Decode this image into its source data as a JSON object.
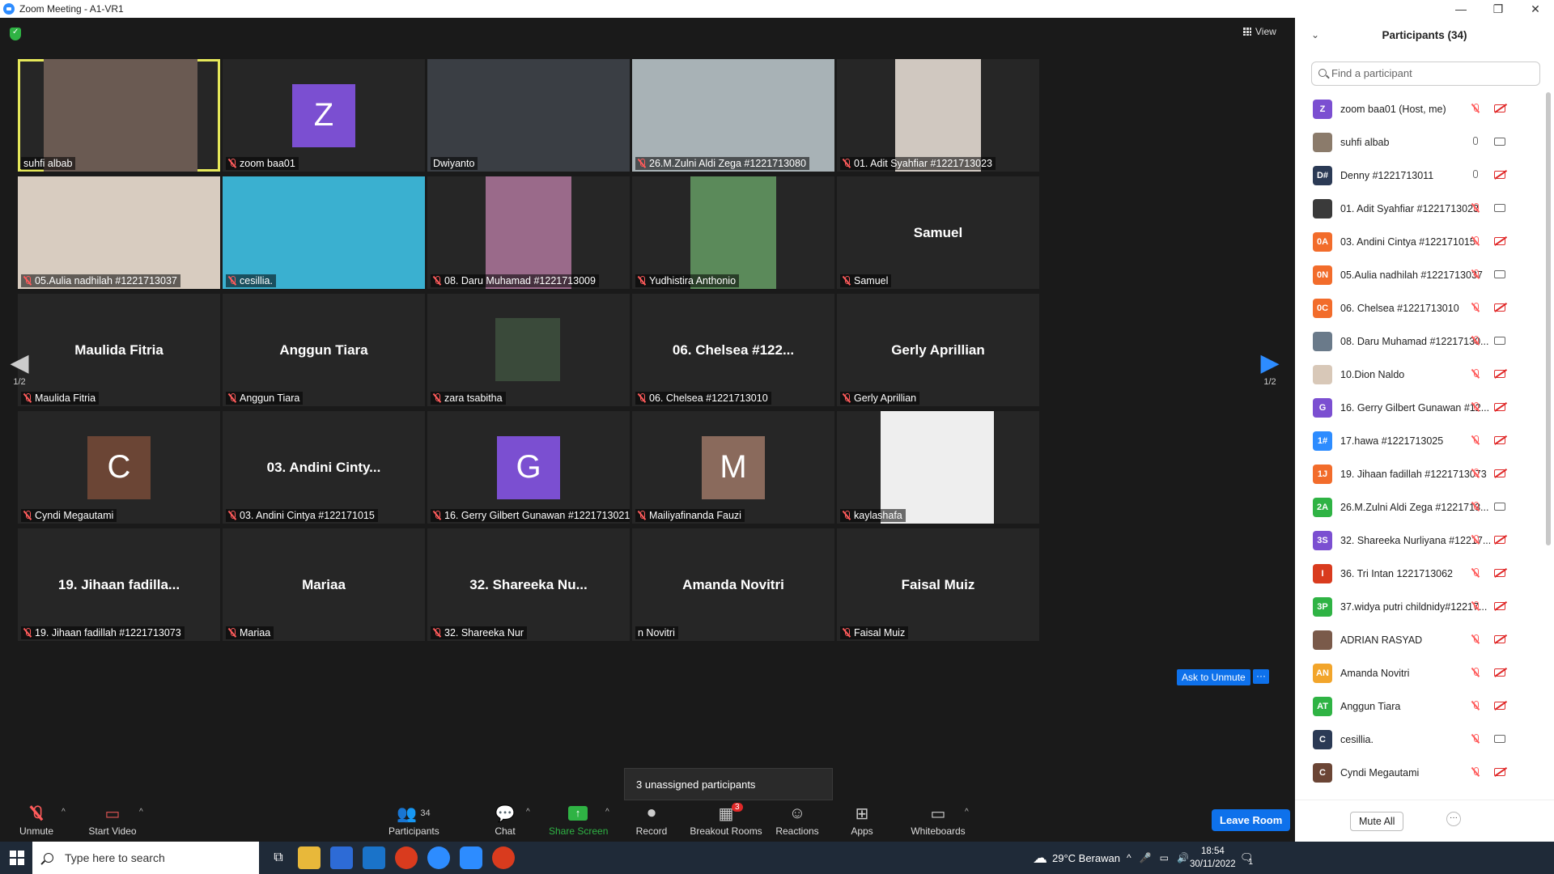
{
  "window": {
    "title": "Zoom Meeting - A1-VR1",
    "controls": [
      "—",
      "❐",
      "✕"
    ]
  },
  "meeting": {
    "view_label": "View",
    "page_indicator_left": "1/2",
    "page_indicator_right": "1/2",
    "ask_to_unmute": "Ask to Unmute",
    "more": "···",
    "unassigned_tooltip": "3 unassigned participants",
    "tiles": [
      {
        "label": "suhfi albab",
        "big": "",
        "avatar": "",
        "muted": false
      },
      {
        "label": "zoom baa01",
        "big": "",
        "avatar": "Z",
        "muted": true
      },
      {
        "label": "Dwiyanto",
        "big": "",
        "avatar": "",
        "muted": false
      },
      {
        "label": "26.M.Zulni Aldi Zega #1221713080",
        "big": "",
        "avatar": "",
        "muted": true
      },
      {
        "label": "01. Adit Syahfiar #1221713023",
        "big": "",
        "avatar": "",
        "muted": true
      },
      {
        "label": "05.Aulia nadhilah #1221713037",
        "big": "",
        "avatar": "",
        "muted": true
      },
      {
        "label": "cesillia.",
        "big": "",
        "avatar": "",
        "muted": true
      },
      {
        "label": "08. Daru Muhamad #1221713009",
        "big": "",
        "avatar": "",
        "muted": true
      },
      {
        "label": "Yudhistira Anthonio",
        "big": "",
        "avatar": "",
        "muted": true
      },
      {
        "label": "Samuel",
        "big": "Samuel",
        "avatar": "",
        "muted": true
      },
      {
        "label": "Maulida Fitria",
        "big": "Maulida Fitria",
        "avatar": "",
        "muted": true
      },
      {
        "label": "Anggun Tiara",
        "big": "Anggun Tiara",
        "avatar": "",
        "muted": true
      },
      {
        "label": "zara tsabitha",
        "big": "",
        "avatar": "",
        "muted": true
      },
      {
        "label": "06. Chelsea #1221713010",
        "big": "06. Chelsea #122...",
        "avatar": "",
        "muted": true
      },
      {
        "label": "Gerly Aprillian",
        "big": "Gerly Aprillian",
        "avatar": "",
        "muted": true
      },
      {
        "label": "Cyndi Megautami",
        "big": "",
        "avatar": "C",
        "muted": true
      },
      {
        "label": "03. Andini Cintya #122171015",
        "big": "03. Andini Cinty...",
        "avatar": "",
        "muted": true
      },
      {
        "label": "16. Gerry Gilbert Gunawan #1221713021",
        "big": "",
        "avatar": "G",
        "muted": true
      },
      {
        "label": "Mailiyafinanda Fauzi",
        "big": "",
        "avatar": "M",
        "muted": true
      },
      {
        "label": "kaylashafa",
        "big": "",
        "avatar": "",
        "muted": true
      },
      {
        "label": "19. Jihaan fadillah #1221713073",
        "big": "19. Jihaan fadilla...",
        "avatar": "",
        "muted": true
      },
      {
        "label": "Mariaa",
        "big": "Mariaa",
        "avatar": "",
        "muted": true
      },
      {
        "label": "32. Shareeka Nur",
        "big": "32. Shareeka Nu...",
        "avatar": "",
        "muted": true
      },
      {
        "label": "n Novitri",
        "big": "Amanda Novitri",
        "avatar": "",
        "muted": false
      },
      {
        "label": "Faisal Muiz",
        "big": "Faisal Muiz",
        "avatar": "",
        "muted": true
      }
    ],
    "avatar_colors": {
      "Z": "#7b4fd1",
      "C": "#6b4535",
      "G": "#7b4fd1",
      "M": "#8a6a5c"
    }
  },
  "toolbar": {
    "unmute": "Unmute",
    "start_video": "Start Video",
    "participants": "Participants",
    "participants_count": "34",
    "chat": "Chat",
    "share_screen": "Share Screen",
    "record": "Record",
    "breakout_rooms": "Breakout Rooms",
    "breakout_badge": "3",
    "reactions": "Reactions",
    "apps": "Apps",
    "whiteboards": "Whiteboards",
    "leave_room": "Leave Room"
  },
  "participants_panel": {
    "title": "Participants (34)",
    "search_placeholder": "Find a participant",
    "mute_all": "Mute All",
    "more": "···",
    "list": [
      {
        "initials": "Z",
        "color": "#7b4fd1",
        "name": "zoom baa01 (Host, me)",
        "mic": "muted",
        "cam": "off"
      },
      {
        "initials": "",
        "color": "#8b7b6b",
        "name": "suhfi albab",
        "mic": "on",
        "cam": "on"
      },
      {
        "initials": "D#",
        "color": "#2b3a55",
        "name": "Denny #1221713011",
        "mic": "on",
        "cam": "off"
      },
      {
        "initials": "",
        "color": "#3a3a3a",
        "name": "01. Adit Syahfiar #1221713023",
        "mic": "muted",
        "cam": "on"
      },
      {
        "initials": "0A",
        "color": "#f26c2b",
        "name": "03. Andini Cintya #122171015",
        "mic": "muted",
        "cam": "off"
      },
      {
        "initials": "0N",
        "color": "#f26c2b",
        "name": "05.Aulia nadhilah #1221713037",
        "mic": "muted",
        "cam": "on"
      },
      {
        "initials": "0C",
        "color": "#f26c2b",
        "name": "06. Chelsea #1221713010",
        "mic": "muted",
        "cam": "off"
      },
      {
        "initials": "",
        "color": "#6a7a8a",
        "name": "08. Daru Muhamad #12217130...",
        "mic": "muted",
        "cam": "on"
      },
      {
        "initials": "",
        "color": "#d8c8b8",
        "name": "10.Dion Naldo",
        "mic": "muted",
        "cam": "off"
      },
      {
        "initials": "G",
        "color": "#7b4fd1",
        "name": "16. Gerry Gilbert Gunawan #12...",
        "mic": "muted",
        "cam": "off"
      },
      {
        "initials": "1#",
        "color": "#2d8cff",
        "name": "17.hawa #1221713025",
        "mic": "muted",
        "cam": "off"
      },
      {
        "initials": "1J",
        "color": "#f26c2b",
        "name": "19. Jihaan fadillah #1221713073",
        "mic": "muted",
        "cam": "off"
      },
      {
        "initials": "2A",
        "color": "#2fb344",
        "name": "26.M.Zulni Aldi Zega #1221713...",
        "mic": "muted",
        "cam": "on"
      },
      {
        "initials": "3S",
        "color": "#7b4fd1",
        "name": "32. Shareeka Nurliyana #12217...",
        "mic": "muted",
        "cam": "off"
      },
      {
        "initials": "I",
        "color": "#d93b1e",
        "name": "36. Tri Intan 1221713062",
        "mic": "muted",
        "cam": "off"
      },
      {
        "initials": "3P",
        "color": "#2fb344",
        "name": "37.widya putri childnidy#12217...",
        "mic": "muted",
        "cam": "off"
      },
      {
        "initials": "",
        "color": "#7a5a4a",
        "name": "ADRIAN RASYAD",
        "mic": "muted",
        "cam": "off"
      },
      {
        "initials": "AN",
        "color": "#f2a52b",
        "name": "Amanda Novitri",
        "mic": "muted",
        "cam": "off"
      },
      {
        "initials": "AT",
        "color": "#2fb344",
        "name": "Anggun Tiara",
        "mic": "muted",
        "cam": "off"
      },
      {
        "initials": "C",
        "color": "#2b3a55",
        "name": "cesillia.",
        "mic": "muted",
        "cam": "on"
      },
      {
        "initials": "C",
        "color": "#6b4535",
        "name": "Cyndi Megautami",
        "mic": "muted",
        "cam": "off"
      }
    ]
  },
  "taskbar": {
    "search_placeholder": "Type here to search",
    "weather": "29°C  Berawan",
    "time": "18:54",
    "date": "30/11/2022",
    "notification_count": "1"
  }
}
